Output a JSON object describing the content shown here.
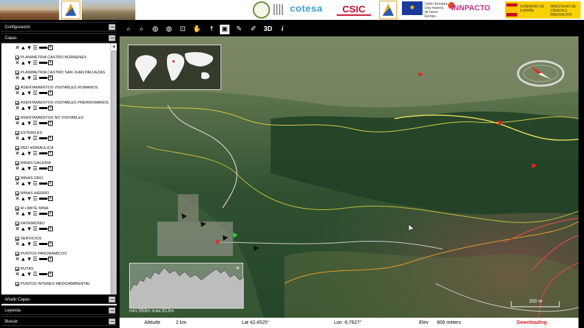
{
  "banner": {
    "cotesa": "cotesa",
    "csic": "CSIC",
    "eu": "★",
    "eu_text": "Unión Europea",
    "eu_sub": "Una manera de hacer Europa",
    "innpacto": "INNPACTO",
    "gov_left": "GOBIERNO DE ESPAÑA",
    "gov_right": "MINISTERIO DE CIENCIA E INNOVACIÓN"
  },
  "sidebar": {
    "config": "Configuración",
    "capas": "Capas",
    "anadir_capas": "Añadir Capas",
    "leyenda": "Leyenda",
    "buscar": "Buscar",
    "layer_tools": {
      "remove": "✕",
      "up": "▲",
      "down": "▼",
      "info": "☰",
      "plus": "+"
    },
    "layers": [
      {
        "name": "PLANIMETRIA CASTRO BORRENES"
      },
      {
        "name": "PLANIMETRIA CASTRO SAN JUAN PALUEZAS"
      },
      {
        "name": "ASENTAMIENTOS VISITABLES ROMANOS"
      },
      {
        "name": "ASENTAMIENTOS VISITABLES PRERROMANOS"
      },
      {
        "name": "ASENTAMIENTOS NO VISITABLES"
      },
      {
        "name": "ESTERILES"
      },
      {
        "name": "RED HIDRAULICA"
      },
      {
        "name": "MINAS GALERIA"
      },
      {
        "name": "MINAS ORO"
      },
      {
        "name": "MINAS HIERRO"
      },
      {
        "name": "M LIMITE MINA"
      },
      {
        "name": "PATRIMONIO"
      },
      {
        "name": "SERVICIOS"
      },
      {
        "name": "PUNTOS PANORAMICOS"
      },
      {
        "name": "RUTAS"
      },
      {
        "name": "PUNTOS INTERES MEDIOAMBIENTAL"
      }
    ]
  },
  "toolbar": {
    "zoom_in": "⌕",
    "zoom_out": "⌕",
    "globe": "◍",
    "zoom_box": "⊡",
    "pan": "✋",
    "figure": "☨",
    "select": "▣",
    "measure": "✎",
    "edit": "✐",
    "view3d": "3D",
    "info": "i"
  },
  "map": {
    "profile_label": "min:393m  max:813m",
    "scale_label": "200 m"
  },
  "status": {
    "altitude_label": "Altitude",
    "altitude_value": "2 km",
    "lat": "Lat 42,4525°",
    "lon": "Lon -6,7627°",
    "elev_label": "Elev",
    "elev_value": "809 meters",
    "downloading": "Downloading"
  }
}
